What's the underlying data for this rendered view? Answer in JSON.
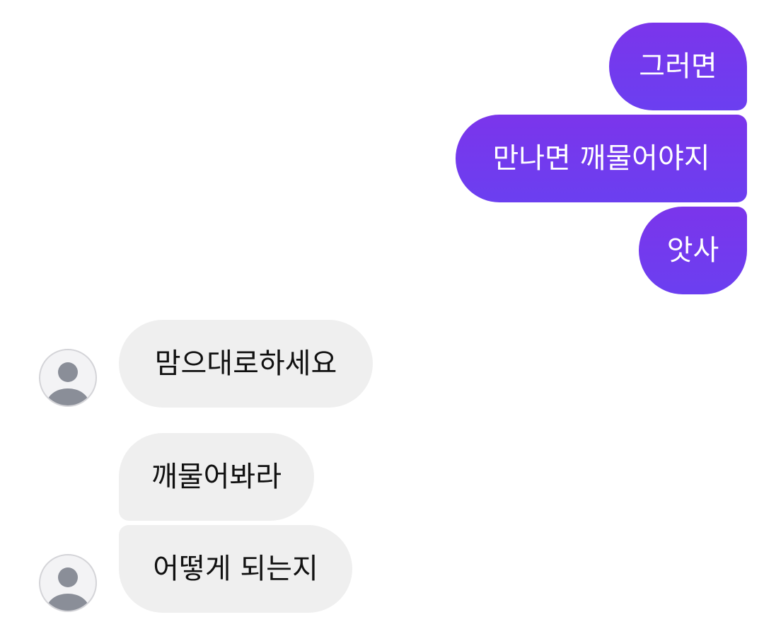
{
  "messages": {
    "sent": [
      {
        "text": "그러면"
      },
      {
        "text": "만나면 깨물어야지"
      },
      {
        "text": "앗사"
      }
    ],
    "received": [
      {
        "text": "맘으대로하세요"
      },
      {
        "text": "깨물어봐라"
      },
      {
        "text": "어떻게 되는지"
      }
    ]
  },
  "colors": {
    "sent_bubble": "#7b35eb",
    "received_bubble": "#efefef",
    "avatar_silhouette": "#8a8e98"
  },
  "icons": {
    "avatar": "default-user-avatar-icon"
  }
}
